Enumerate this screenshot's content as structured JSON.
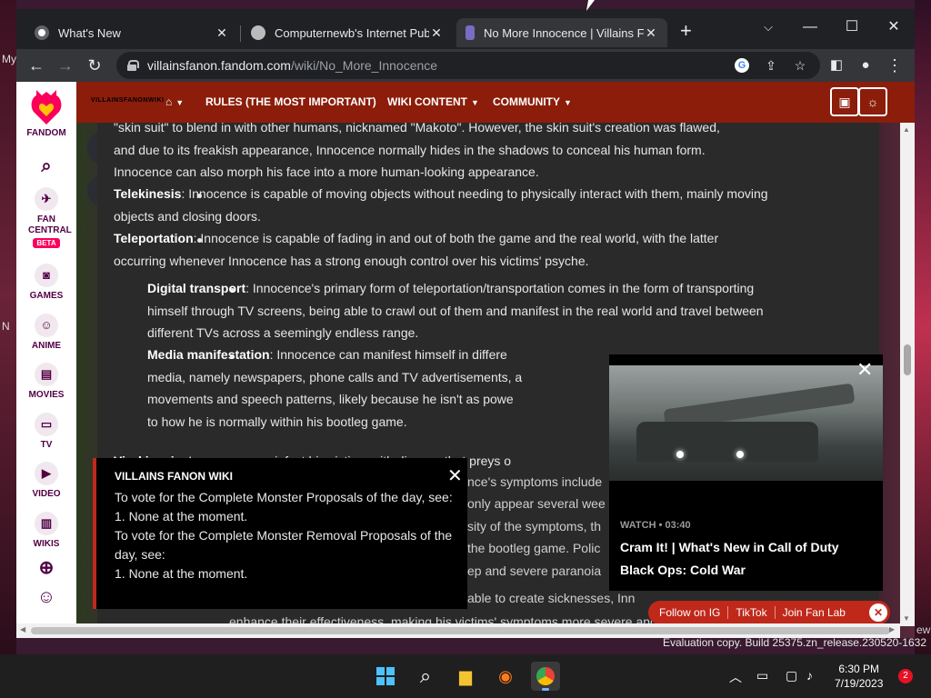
{
  "desktop": {
    "left_text_1": "My",
    "left_text_2": "N",
    "right_text": "ew",
    "evaluation": "Evaluation copy. Build 25375.zn_release.230520-1632"
  },
  "tabs": [
    {
      "title": "What's New",
      "icon": "chrome-icon"
    },
    {
      "title": "Computernewb's Internet Pub H",
      "icon": "pub-icon"
    },
    {
      "title": "No More Innocence | Villains Far",
      "icon": "fandom-icon"
    }
  ],
  "window_controls": {
    "minimize": "—",
    "maximize": "☐",
    "close": "✕",
    "dropdown": "⌵"
  },
  "toolbar": {
    "url_host": "villainsfanon.fandom.com",
    "url_path": "/wiki/No_More_Innocence"
  },
  "rail": {
    "logo": "FANDOM",
    "fan_central": "FAN CENTRAL",
    "beta": "BETA",
    "games": "GAMES",
    "anime": "ANIME",
    "movies": "MOVIES",
    "tv": "TV",
    "video": "VIDEO",
    "wikis": "WIKIS"
  },
  "navbar": {
    "wordmark": "VILLAINSFANONWIKI",
    "rules": "RULES (THE MOST IMPORTANT)",
    "wiki_content": "WIKI CONTENT",
    "community": "COMMUNITY"
  },
  "article": {
    "skin_lines": [
      "\"skin suit\" to blend in with other humans, nicknamed \"Makoto\". However, the skin suit's creation was flawed,",
      "and due to its freakish appearance, Innocence normally hides in the shadows to conceal his human form.",
      "Innocence can also morph his face into a more human-looking appearance."
    ],
    "telekinesis_term": "Telekinesis",
    "telekinesis_text": ": Innocence is capable of moving objects without needing to physically interact with them, mainly moving objects and closing doors.",
    "teleportation_term": "Teleportation",
    "teleportation_text": ": Innocence is capable of fading in and out of both the game and the real world, with the latter occurring whenever Innocence has a strong enough control over his victims' psyche.",
    "digital_term": "Digital transport",
    "digital_text": ": Innocence's primary form of teleportation/transportation comes in the form of transporting himself through TV screens, being able to crawl out of them and manifest in the real world and travel between different TVs across a seemingly endless range.",
    "media_term": "Media manifestation",
    "media_lines": [
      ": Innocence can manifest himself in differe",
      "media, namely newspapers, phone calls and TV advertisements, a",
      "movements and speech patterns, likely because he isn't as powe",
      "to how he is normally within his bootleg game."
    ],
    "virokinesis_term": "Virokinesis",
    "virokinesis_text": ": Innocence can infect his victims with disease that preys o",
    "behind_lines": [
      "nce's symptoms include",
      "only appear several wee",
      "sity of the symptoms, th",
      "the bootleg game. Polic",
      "ep and severe paranoia"
    ],
    "disease_line": "able to create sicknesses, Inn",
    "bottom_line": "enhance their effectiveness, making his victims' symptoms more severe and leading to their mortal"
  },
  "notice": {
    "title": "VILLAINS FANON WIKI",
    "lines": [
      "To vote for the Complete Monster Proposals of the day, see:",
      "1. None at the moment.",
      "To vote for the Complete Monster Removal Proposals of the",
      "day, see:",
      "1. None at the moment."
    ]
  },
  "video": {
    "meta": "WATCH • 03:40",
    "title": "Cram It! | What's New in Call of Duty Black Ops: Cold War"
  },
  "social": {
    "instagram": "Follow on IG",
    "tiktok": "TikTok",
    "fanlab": "Join Fan Lab"
  },
  "taskbar": {
    "time": "6:30 PM",
    "date": "7/19/2023",
    "notifications": "2"
  },
  "colors": {
    "fandom_navbar": "#8b1d0a",
    "accent_red": "#c0281a",
    "fandom_pink": "#fa005a"
  }
}
